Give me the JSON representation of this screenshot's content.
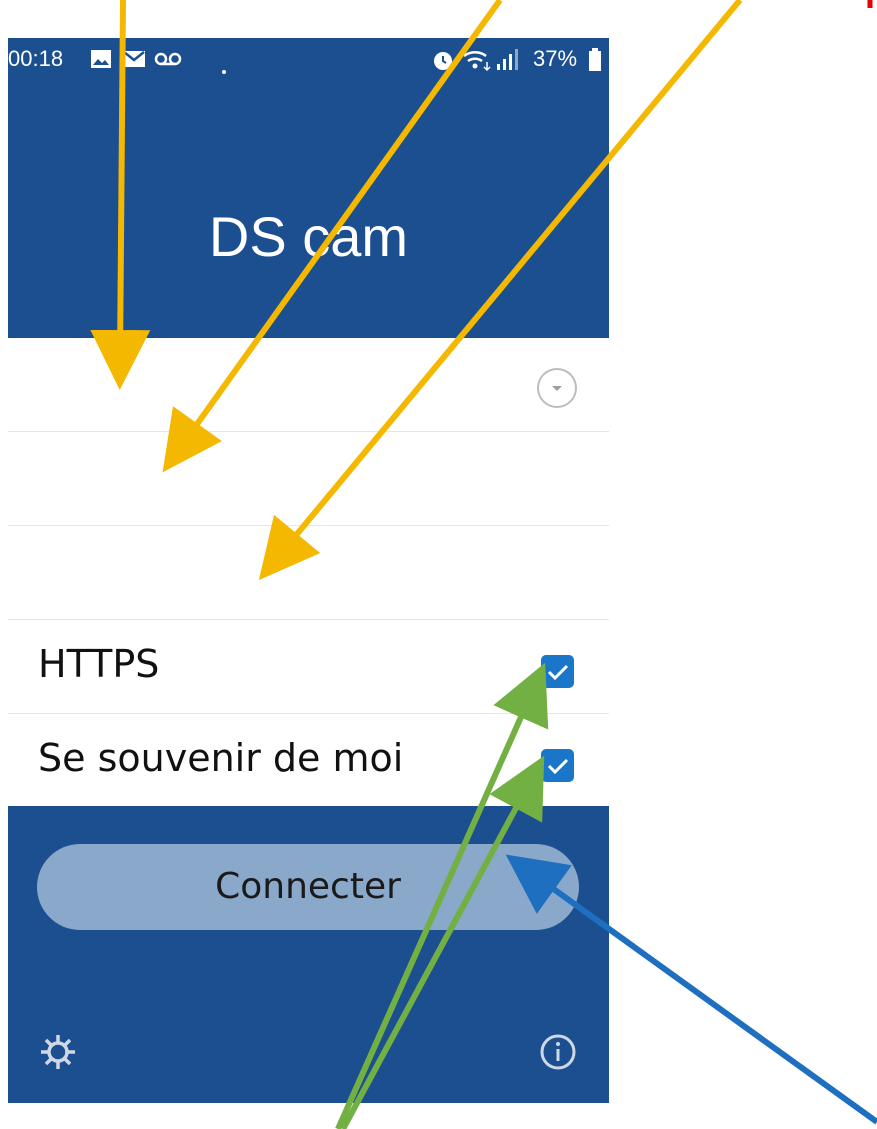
{
  "status_bar": {
    "time": "00:18",
    "battery": "37%",
    "icons": [
      "image-icon",
      "mail-icon",
      "voicemail-icon",
      "dot-icon",
      "alarm-icon",
      "wifi-icon",
      "signal-icon",
      "battery-icon"
    ]
  },
  "header": {
    "title": "DS cam"
  },
  "form": {
    "https_label": "HTTPS",
    "https_checked": true,
    "remember_label": "Se souvenir de moi",
    "remember_checked": true
  },
  "footer": {
    "connect_label": "Connecter",
    "icons": [
      "gear-icon",
      "info-icon"
    ]
  },
  "annotation_colors": {
    "orange": "#f5b800",
    "green": "#72b043",
    "blue": "#1f6fc0",
    "red": "#e60000",
    "header_blue": "#1b4f8f",
    "checkbox_blue": "#1976c9"
  }
}
